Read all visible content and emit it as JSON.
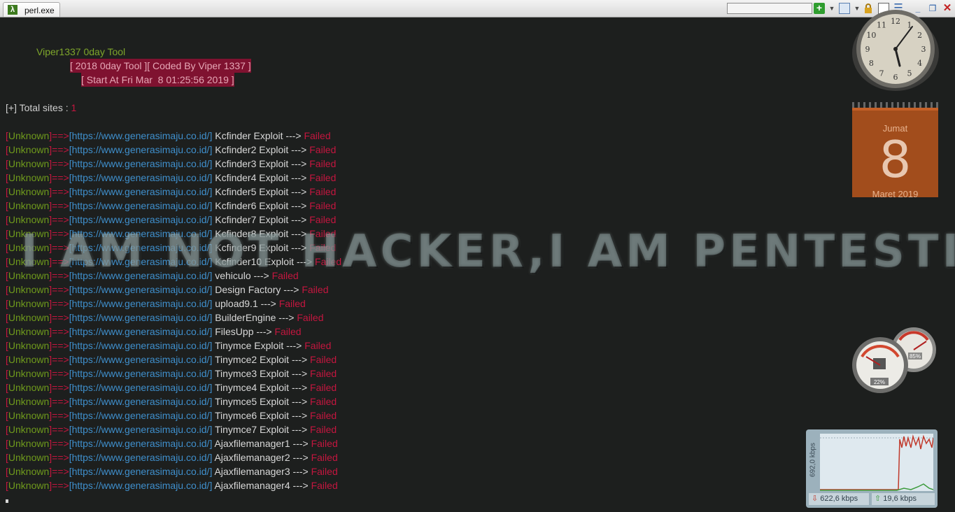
{
  "titlebar": {
    "tab_label": "perl.exe",
    "tab_icon": "λ",
    "search_value": ""
  },
  "banner": {
    "title": "Viper1337 0day Tool",
    "coded": "[ 2018 0day Tool ][ Coded By Viper 1337 ]",
    "start": "[ Start At Fri Mar  8 01:25:56 2019 ]"
  },
  "total": {
    "label": "[+] Total sites : ",
    "value": "1"
  },
  "watermark": "I AM NOT HACKER,I AM PENTESTING",
  "log": {
    "open": "[",
    "status": "Unknown",
    "close_arrow": "]==>",
    "url": "[https://www.generasimaju.co.id/]",
    "arrow": " ---> ",
    "result": "Failed",
    "entries": [
      "Kcfinder Exploit",
      "Kcfinder2 Exploit",
      "Kcfinder3 Exploit",
      "Kcfinder4 Exploit",
      "Kcfinder5 Exploit",
      "Kcfinder6 Exploit",
      "Kcfinder7 Exploit",
      "Kcfinder8 Exploit",
      "Kcfinder9 Exploit",
      "Kcfinder10 Exploit",
      "vehiculo",
      "Design Factory",
      "upload9.1",
      "BuilderEngine",
      "FilesUpp",
      "Tinymce Exploit",
      "Tinymce2 Exploit",
      "Tinymce3 Exploit",
      "Tinymce4 Exploit",
      "Tinymce5 Exploit",
      "Tinymce6 Exploit",
      "Tinymce7 Exploit",
      "Ajaxfilemanager1",
      "Ajaxfilemanager2",
      "Ajaxfilemanager3",
      "Ajaxfilemanager4"
    ]
  },
  "gadgets": {
    "clock": {
      "hour_numerals": [
        "12",
        "1",
        "2",
        "3",
        "4",
        "5",
        "6",
        "7",
        "8",
        "9",
        "10",
        "11"
      ],
      "time": "01:25"
    },
    "calendar": {
      "day": "Jumat",
      "date": "8",
      "month": "Maret 2019"
    },
    "meters": {
      "cpu": "22%",
      "memory": "85%",
      "cpu_level": 0.22,
      "memory_level": 0.85
    },
    "network": {
      "scale": "692,0 kbps",
      "down": "622,6 kbps",
      "up": "19,6 kbps"
    }
  },
  "colors": {
    "accent_red": "#c4163f",
    "status_green": "#6f9a1c",
    "url_blue": "#3f8fcc",
    "banner_bg": "#7f1230"
  }
}
